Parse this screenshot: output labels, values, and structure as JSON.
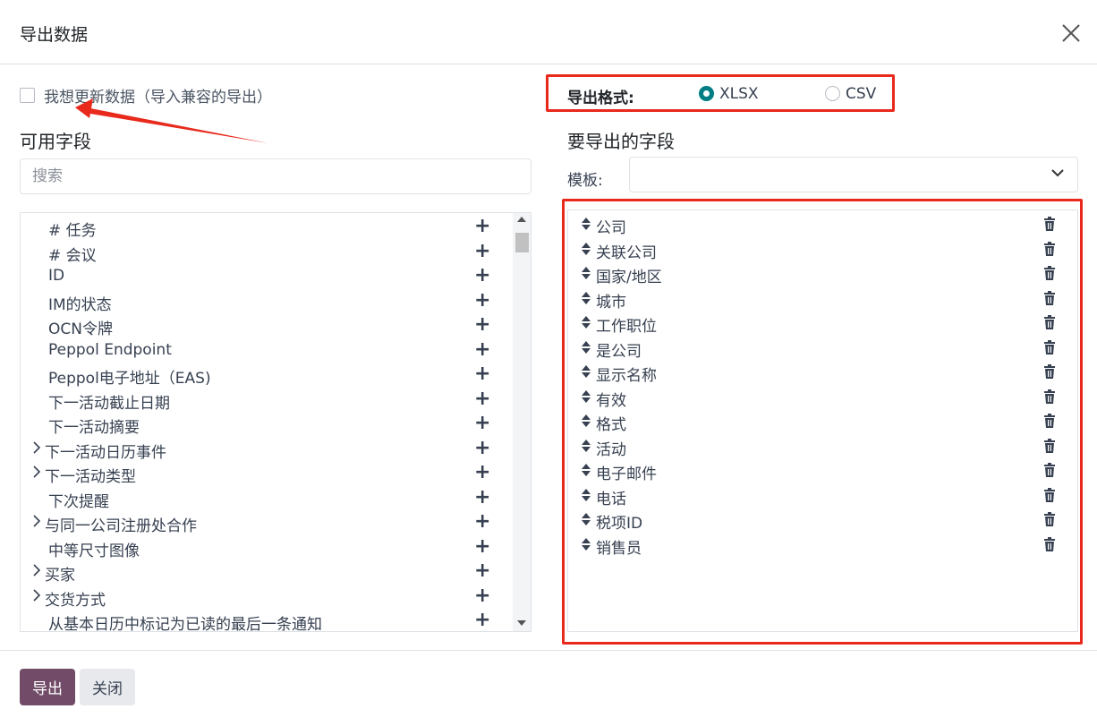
{
  "dialog": {
    "title": "导出数据"
  },
  "options": {
    "compat_label": "我想更新数据（导入兼容的导出）",
    "compat_checked": false
  },
  "available": {
    "title": "可用字段",
    "search_placeholder": "搜索",
    "fields": [
      {
        "label": "# 任务",
        "expandable": false
      },
      {
        "label": "# 会议",
        "expandable": false
      },
      {
        "label": "ID",
        "expandable": false
      },
      {
        "label": "IM的状态",
        "expandable": false
      },
      {
        "label": "OCN令牌",
        "expandable": false
      },
      {
        "label": "Peppol Endpoint",
        "expandable": false
      },
      {
        "label": "Peppol电子地址（EAS)",
        "expandable": false
      },
      {
        "label": "下一活动截止日期",
        "expandable": false
      },
      {
        "label": "下一活动摘要",
        "expandable": false
      },
      {
        "label": "下一活动日历事件",
        "expandable": true
      },
      {
        "label": "下一活动类型",
        "expandable": true
      },
      {
        "label": "下次提醒",
        "expandable": false
      },
      {
        "label": "与同一公司注册处合作",
        "expandable": true
      },
      {
        "label": "中等尺寸图像",
        "expandable": false
      },
      {
        "label": "买家",
        "expandable": true
      },
      {
        "label": "交货方式",
        "expandable": true
      },
      {
        "label": "从基本日历中标记为已读的最后一条通知",
        "expandable": false
      }
    ]
  },
  "format": {
    "label": "导出格式:",
    "options": [
      {
        "label": "XLSX",
        "selected": true
      },
      {
        "label": "CSV",
        "selected": false
      }
    ]
  },
  "export_fields": {
    "title": "要导出的字段",
    "template_label": "模板:",
    "template_value": "",
    "fields": [
      "公司",
      "关联公司",
      "国家/地区",
      "城市",
      "工作职位",
      "是公司",
      "显示名称",
      "有效",
      "格式",
      "活动",
      "电子邮件",
      "电话",
      "税项ID",
      "销售员"
    ]
  },
  "footer": {
    "export_label": "导出",
    "close_label": "关闭"
  },
  "colors": {
    "primary": "#714b67",
    "radio": "#017e84",
    "annotation": "#e8291c"
  }
}
